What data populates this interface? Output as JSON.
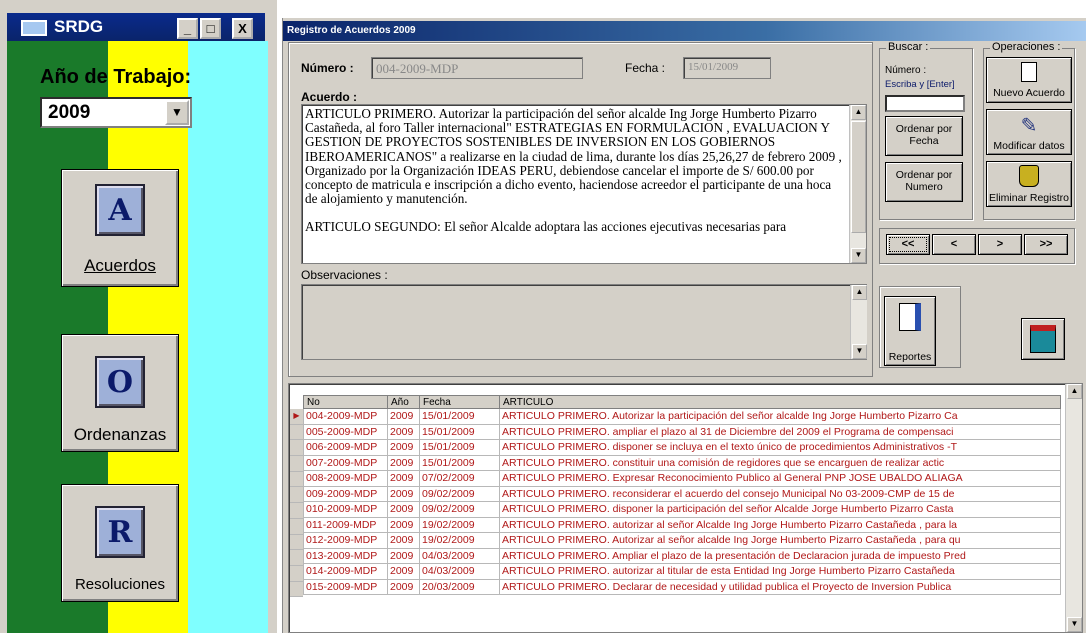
{
  "left_window": {
    "title": "SRDG",
    "minimize": "_",
    "maximize": "□",
    "close": "X",
    "year_label": "Año de Trabajo:",
    "year_value": "2009",
    "buttons": [
      {
        "letter": "A",
        "label": "Acuerdos"
      },
      {
        "letter": "O",
        "label": "Ordenanzas"
      },
      {
        "letter": "R",
        "label": "Resoluciones"
      }
    ],
    "stripe_colors": [
      "#1a7a2a",
      "#ffff00",
      "#7fffff"
    ]
  },
  "form": {
    "title": "Registro de Acuerdos   2009",
    "numero_label": "Número :",
    "numero_value": "004-2009-MDP",
    "fecha_label": "Fecha :",
    "fecha_value": "15/01/2009",
    "acuerdo_label": "Acuerdo :",
    "acuerdo_text": "ARTICULO PRIMERO. Autorizar la participación del señor alcalde  Ing Jorge Humberto Pizarro Castañeda, al foro Taller internacional\" ESTRATEGIAS EN FORMULACION , EVALUACION  Y GESTION DE PROYECTOS SOSTENIBLES DE INVERSION EN LOS GOBIERNOS IBEROAMERICANOS\" a realizarse en la ciudad de lima, durante los días 25,26,27 de febrero 2009 , Organizado por la Organización IDEAS PERU, debiendose cancelar el importe de S/ 600.00 por concepto de matricula e inscripción a dicho evento, haciendose acreedor el participante de una hoca de alojamiento y manutención.",
    "acuerdo_text_2": "ARTICULO SEGUNDO: El señor Alcalde adoptara las acciones ejecutivas necesarias para",
    "observaciones_label": "Observaciones :",
    "observaciones_value": ""
  },
  "buscar": {
    "title": "Buscar :",
    "hint_line1": "Número :",
    "hint_line2": "Escriba y [Enter]",
    "input_value": "",
    "order_fecha": "Ordenar por Fecha",
    "order_numero": "Ordenar por Numero"
  },
  "operaciones": {
    "title": "Operaciones :",
    "nuevo": "Nuevo Acuerdo",
    "modificar": "Modificar datos",
    "eliminar": "Eliminar Registro"
  },
  "navigation": {
    "first": "<<",
    "prev": "<",
    "next": ">",
    "last": ">>"
  },
  "reportes": {
    "label": "Reportes"
  },
  "grid": {
    "columns": [
      "No",
      "Año",
      "Fecha",
      "ARTICULO"
    ],
    "rows": [
      [
        "004-2009-MDP",
        "2009",
        "15/01/2009",
        "ARTICULO PRIMERO. Autorizar la participación del señor alcalde  Ing Jorge Humberto Pizarro Ca"
      ],
      [
        "005-2009-MDP",
        "2009",
        "15/01/2009",
        "ARTICULO PRIMERO. ampliar el plazo al 31 de Diciembre del 2009 el Programa de compensaci"
      ],
      [
        "006-2009-MDP",
        "2009",
        "15/01/2009",
        "ARTICULO PRIMERO. disponer se incluya en el texto único de procedimientos Administrativos -T"
      ],
      [
        "007-2009-MDP",
        "2009",
        "15/01/2009",
        "ARTICULO PRIMERO. constituir una comisión de regidores  que se encarguen de realizar actic"
      ],
      [
        "008-2009-MDP",
        "2009",
        "07/02/2009",
        "ARTICULO PRIMERO. Expresar Reconocimiento Publico al General PNP JOSE UBALDO ALIAGA"
      ],
      [
        "009-2009-MDP",
        "2009",
        "09/02/2009",
        "ARTICULO PRIMERO. reconsiderar el acuerdo del consejo Municipal No 03-2009-CMP de 15 de"
      ],
      [
        "010-2009-MDP",
        "2009",
        "09/02/2009",
        "ARTICULO PRIMERO. disponer la participación del señor Alcalde Jorge Humberto Pizarro Casta"
      ],
      [
        "011-2009-MDP",
        "2009",
        "19/02/2009",
        "ARTICULO PRIMERO. autorizar al señor Alcalde Ing Jorge Humberto Pizarro Castañeda , para la"
      ],
      [
        "012-2009-MDP",
        "2009",
        "19/02/2009",
        "ARTICULO PRIMERO. Autorizar al señor alcalde Ing Jorge Humberto Pizarro Castañeda , para qu"
      ],
      [
        "013-2009-MDP",
        "2009",
        "04/03/2009",
        "ARTICULO PRIMERO. Ampliar el plazo de la presentación de Declaracion jurada de impuesto Pred"
      ],
      [
        "014-2009-MDP",
        "2009",
        "04/03/2009",
        "ARTICULO PRIMERO. autorizar al titular de esta Entidad Ing Jorge Humberto Pizarro Castañeda"
      ],
      [
        "015-2009-MDP",
        "2009",
        "20/03/2009",
        "ARTICULO PRIMERO. Declarar de necesidad y utilidad publica el Proyecto de Inversion Publica"
      ]
    ],
    "selected_marker": "▶"
  }
}
